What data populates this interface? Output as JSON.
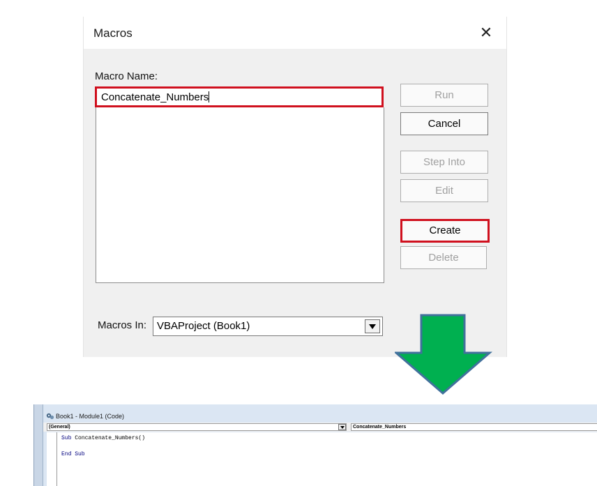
{
  "macros_dialog": {
    "title": "Macros",
    "close_glyph": "✕",
    "macro_name_label": "Macro Name:",
    "macro_name_value": "Concatenate_Numbers",
    "buttons": {
      "run": "Run",
      "cancel": "Cancel",
      "step_into": "Step Into",
      "edit": "Edit",
      "create": "Create",
      "delete": "Delete"
    },
    "macros_in_label": "Macros In:",
    "macros_in_value": "VBAProject (Book1)"
  },
  "arrow": {
    "color": "#00b050",
    "outline": "#41719c"
  },
  "highlight_color": "#d0101e",
  "code_window": {
    "title": "Book1 - Module1 (Code)",
    "object_combo": "(General)",
    "procedure_combo": "Concatenate_Numbers",
    "code": {
      "line1_keyword": "Sub",
      "line1_rest": " Concatenate_Numbers()",
      "line2": "End Sub"
    }
  }
}
